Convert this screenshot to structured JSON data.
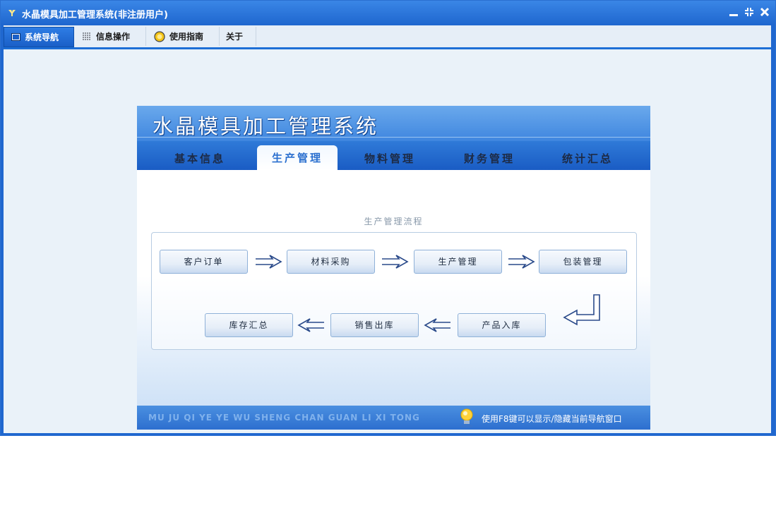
{
  "window": {
    "title": "水晶模具加工管理系统(非注册用户)"
  },
  "menu": [
    {
      "label": "系统导航",
      "icon": "monitor-icon"
    },
    {
      "label": "信息操作",
      "icon": "grid-icon"
    },
    {
      "label": "使用指南",
      "icon": "help-icon"
    },
    {
      "label": "关于",
      "icon": ""
    }
  ],
  "app": {
    "title": "水晶模具加工管理系统",
    "tabs": [
      "基本信息",
      "生产管理",
      "物料管理",
      "财务管理",
      "统计汇总"
    ],
    "active_tab": "生产管理",
    "flow": {
      "title": "生产管理流程",
      "row1": [
        "客户订单",
        "材料采购",
        "生产管理",
        "包装管理"
      ],
      "row2": [
        "库存汇总",
        "销售出库",
        "产品入库"
      ]
    },
    "footer": {
      "pinyin": "MU JU QI YE YE WU SHENG CHAN GUAN LI XI TONG",
      "hint": "使用F8键可以显示/隐藏当前导航窗口"
    }
  },
  "colors": {
    "accent": "#1f67cf",
    "tab_active_text": "#2a6fcf"
  }
}
